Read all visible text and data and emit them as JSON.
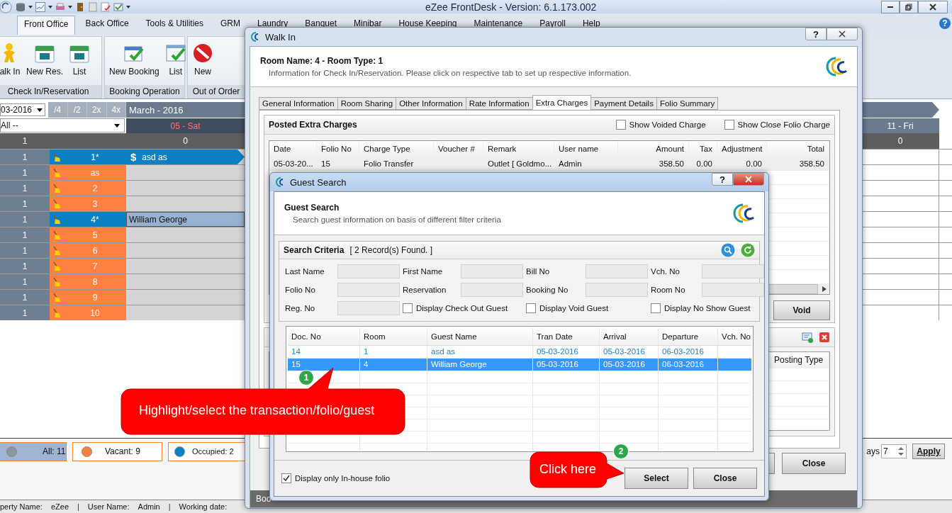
{
  "app": {
    "title": "eZee FrontDesk - Version: 6.1.173.002",
    "help_glyph": "?"
  },
  "ribbon_tabs": [
    {
      "label": "Front Office",
      "selected": true
    },
    {
      "label": "Back Office",
      "selected": false
    },
    {
      "label": "Tools & Utilities",
      "selected": false
    },
    {
      "label": "GRM",
      "selected": false
    },
    {
      "label": "Laundry",
      "selected": false
    },
    {
      "label": "Banquet",
      "selected": false
    },
    {
      "label": "Minibar",
      "selected": false
    },
    {
      "label": "House Keeping",
      "selected": false
    },
    {
      "label": "Maintenance",
      "selected": false
    },
    {
      "label": "Payroll",
      "selected": false
    },
    {
      "label": "Help",
      "selected": false
    }
  ],
  "ribbon_groups": [
    {
      "label": "Check In/Reservation",
      "buttons": [
        "alk In",
        "New Res.",
        "List"
      ]
    },
    {
      "label": "Booking Operation",
      "buttons": [
        "New Booking",
        "List"
      ]
    },
    {
      "label": "Out of Order",
      "buttons": [
        "New"
      ]
    }
  ],
  "room_grid": {
    "date_value": "03-2016",
    "zoom_buttons": [
      "/4",
      "/2",
      "2x",
      "4x"
    ],
    "month": "March - 2016",
    "filter": "All --",
    "total_count": "1",
    "days": [
      {
        "label": "05 - Sat",
        "count": "0",
        "weekend": true
      },
      {
        "label": "11 - Fri",
        "count": "0",
        "weekend": false
      }
    ],
    "rooms": [
      {
        "count": "1",
        "room": "1*",
        "occupied": true,
        "booking": {
          "label": "asd as",
          "kind": "bar",
          "mark": "$"
        }
      },
      {
        "count": "1",
        "room": "as",
        "occupied": false
      },
      {
        "count": "1",
        "room": "2",
        "occupied": false
      },
      {
        "count": "1",
        "room": "3",
        "occupied": false
      },
      {
        "count": "1",
        "room": "4*",
        "occupied": true,
        "booking": {
          "label": "William George",
          "kind": "picked"
        }
      },
      {
        "count": "1",
        "room": "5",
        "occupied": false
      },
      {
        "count": "1",
        "room": "6",
        "occupied": false
      },
      {
        "count": "1",
        "room": "7",
        "occupied": false
      },
      {
        "count": "1",
        "room": "8",
        "occupied": false
      },
      {
        "count": "1",
        "room": "9",
        "occupied": false
      },
      {
        "count": "1",
        "room": "10",
        "occupied": false
      }
    ]
  },
  "legend": [
    {
      "label": "All: 11",
      "color": "#8a96a3",
      "selected": true
    },
    {
      "label": "Vacant: 9",
      "color": "#f5813f",
      "selected": false
    },
    {
      "label": "Occupied: 2",
      "color": "#0a7fc2",
      "selected": false
    }
  ],
  "days_control": {
    "label": "ays",
    "value": "7",
    "apply": "Apply"
  },
  "status_bar": [
    {
      "label": "perty Name:",
      "value": "eZee",
      "separator": "|"
    },
    {
      "label": "User Name:",
      "value": "Admin",
      "separator": "|"
    },
    {
      "label": "Working date:"
    }
  ],
  "walk_in": {
    "title": "Walk In",
    "help_glyph": "?",
    "heading": "Room Name: 4 - Room Type: 1",
    "subtitle": "Information for Check In/Reservation. Please click on respective tab to set up respective information.",
    "tabs": [
      {
        "label": "General Information",
        "selected": false
      },
      {
        "label": "Room Sharing",
        "selected": false
      },
      {
        "label": "Other Information",
        "selected": false
      },
      {
        "label": "Rate Information",
        "selected": false
      },
      {
        "label": "Extra Charges",
        "selected": true
      },
      {
        "label": "Payment Details",
        "selected": false
      },
      {
        "label": "Folio Summary",
        "selected": false
      }
    ],
    "charges_title": "Posted Extra Charges",
    "options": [
      {
        "label": "Show Voided Charge",
        "checked": false
      },
      {
        "label": "Show Close Folio Charge",
        "checked": false
      }
    ],
    "columns": [
      "Date",
      "Folio No",
      "Charge Type",
      "Voucher #",
      "Remark",
      "User name",
      "Amount",
      "Tax",
      "Adjustment",
      "Total"
    ],
    "rows": [
      {
        "date": "05-03-20...",
        "folio_no": "15",
        "charge_type": "Folio Transfer",
        "remark": "Outlet [ Goldmo...",
        "user_name": "Admin",
        "amount": "358.50",
        "tax": "0.00",
        "adjustment": "0.00",
        "total": "358.50"
      }
    ],
    "void_button": "Void",
    "posting_column": "Posting Type",
    "close_button": "Close",
    "footer_text": "Boo"
  },
  "guest_search": {
    "title": "Guest Search",
    "help_glyph": "?",
    "heading": "Guest Search",
    "subtitle": "Search guest information on basis of different filter criteria",
    "criteria_title": "Search Criteria",
    "found": "[ 2 Record(s) Found. ]",
    "fields": [
      "Last Name",
      "First Name",
      "Bill No",
      "Vch. No",
      "Folio No",
      "Reservation",
      "Booking No",
      "Room No",
      "Reg. No"
    ],
    "filters": [
      {
        "label": "Display Check Out Guest",
        "checked": false
      },
      {
        "label": "Display Void Guest",
        "checked": false
      },
      {
        "label": "Display No Show Guest",
        "checked": false
      }
    ],
    "columns": [
      "Doc. No",
      "Room",
      "Guest Name",
      "Tran Date",
      "Arrival",
      "Departure",
      "Vch. No"
    ],
    "rows": [
      {
        "cells": [
          "14",
          "1",
          "asd as",
          "05-03-2016",
          "05-03-2016",
          "06-03-2016"
        ],
        "selected": false
      },
      {
        "cells": [
          "15",
          "4",
          "William George",
          "05-03-2016",
          "05-03-2016",
          "06-03-2016"
        ],
        "selected": true
      }
    ],
    "in_house": {
      "label": "Display only In-house folio",
      "checked": true
    },
    "buttons": [
      "Select",
      "Close"
    ]
  },
  "callouts": [
    {
      "text": "Highlight/select the transaction/folio/guest",
      "step": "1"
    },
    {
      "text": "Click here",
      "step": "2"
    }
  ]
}
